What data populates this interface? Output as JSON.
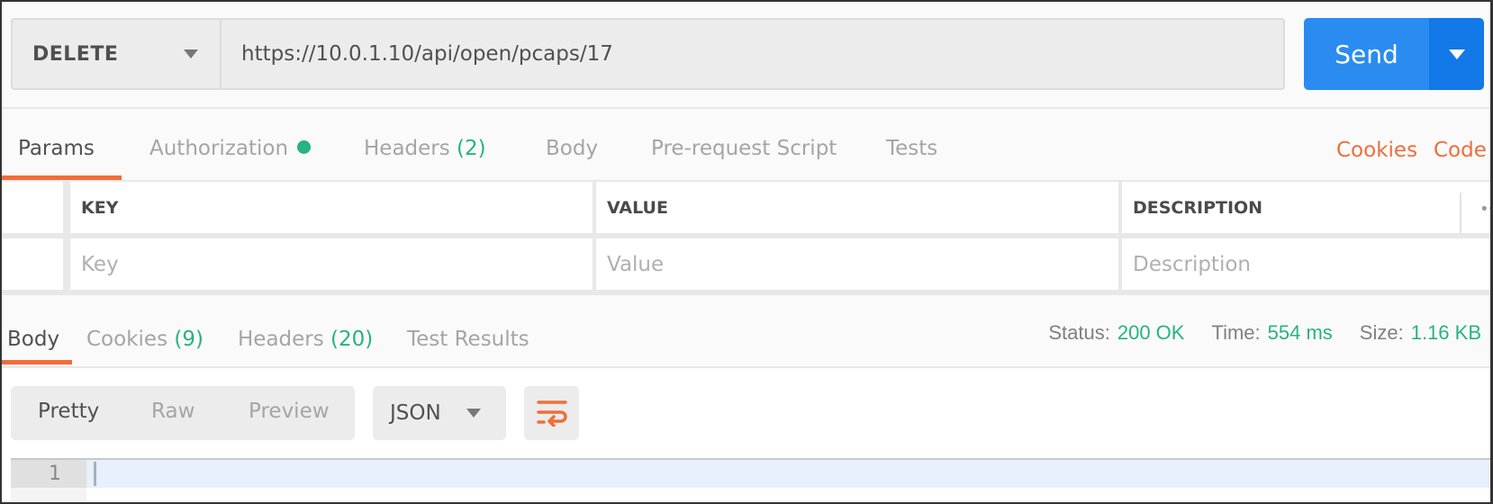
{
  "request": {
    "method": "DELETE",
    "url": "https://10.0.1.10/api/open/pcaps/17",
    "send_label": "Send"
  },
  "request_tabs": [
    {
      "label": "Params",
      "active": true
    },
    {
      "label": "Authorization",
      "indicator": "green-dot"
    },
    {
      "label": "Headers",
      "count": "(2)"
    },
    {
      "label": "Body"
    },
    {
      "label": "Pre-request Script"
    },
    {
      "label": "Tests"
    }
  ],
  "request_links": {
    "cookies": "Cookies",
    "code": "Code"
  },
  "params_table": {
    "headers": [
      "KEY",
      "VALUE",
      "DESCRIPTION"
    ],
    "placeholders": [
      "Key",
      "Value",
      "Description"
    ]
  },
  "response_tabs": [
    {
      "label": "Body",
      "active": true
    },
    {
      "label": "Cookies",
      "count": "(9)"
    },
    {
      "label": "Headers",
      "count": "(20)"
    },
    {
      "label": "Test Results"
    }
  ],
  "response_meta": {
    "status_label": "Status:",
    "status_value": "200 OK",
    "time_label": "Time:",
    "time_value": "554 ms",
    "size_label": "Size:",
    "size_value": "1.16 KB"
  },
  "view_modes": [
    "Pretty",
    "Raw",
    "Preview"
  ],
  "active_view_mode": "Pretty",
  "format": "JSON",
  "editor": {
    "line_numbers": [
      "1"
    ]
  },
  "colors": {
    "accent": "#f06d3a",
    "send": "#2a8cf0",
    "success": "#26b47f"
  }
}
